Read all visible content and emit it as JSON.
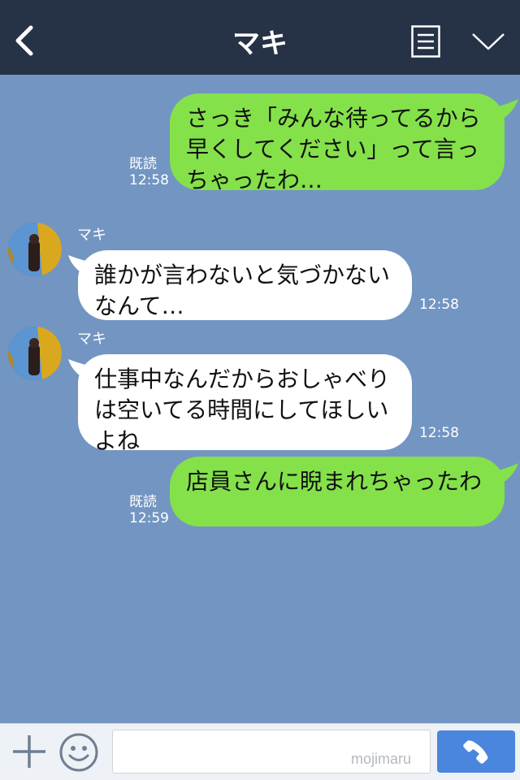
{
  "header": {
    "title": "マキ",
    "back_icon": "chevron-left-icon",
    "menu_icon": "list-icon",
    "collapse_icon": "chevron-down-icon"
  },
  "messages": [
    {
      "side": "me",
      "text": "さっき「みんな待ってるから早くしてください」って言っちゃったわ…",
      "read": "既読",
      "time": "12:58"
    },
    {
      "side": "them",
      "sender": "マキ",
      "text": "誰かが言わないと気づかないなんて…",
      "time": "12:58"
    },
    {
      "side": "them",
      "sender": "マキ",
      "text": "仕事中なんだからおしゃべりは空いてる時間にしてほしいよね",
      "time": "12:58"
    },
    {
      "side": "me",
      "text": "店員さんに睨まれちゃったわ",
      "read": "既読",
      "time": "12:59"
    }
  ],
  "footer": {
    "input_value": "",
    "watermark": "mojimaru",
    "plus_icon": "plus-icon",
    "emoji_icon": "smiley-icon",
    "call_icon": "phone-icon"
  },
  "colors": {
    "header_bg": "#263246",
    "chat_bg": "#7395c2",
    "my_bubble": "#84e14a",
    "their_bubble": "#ffffff",
    "call_button": "#4a86de"
  }
}
